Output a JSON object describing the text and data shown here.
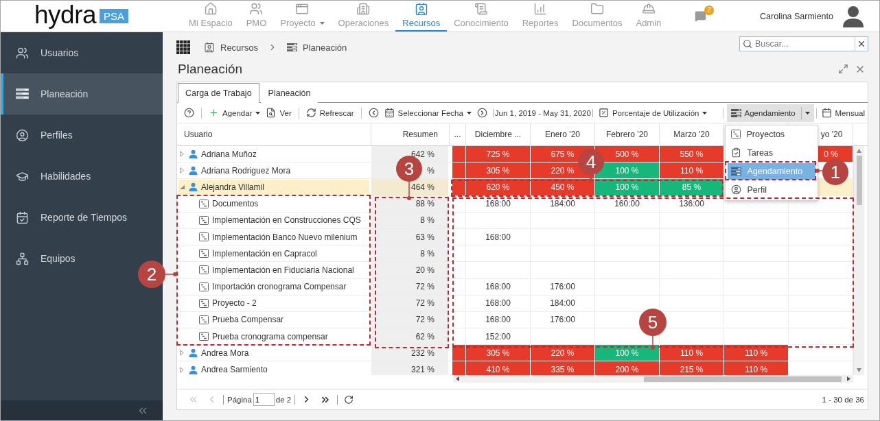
{
  "top_bar": {
    "logo": {
      "name": "hydra",
      "badge": "PSA"
    },
    "nav": [
      {
        "kind": "home",
        "label": "Mi Espacio",
        "selected": false
      },
      {
        "kind": "team",
        "label": "PMO",
        "selected": false
      },
      {
        "kind": "project",
        "label": "Proyecto",
        "selected": false,
        "caret": true
      },
      {
        "kind": "operations",
        "label": "Operaciones",
        "selected": false
      },
      {
        "kind": "resources",
        "label": "Recursos",
        "selected": true
      },
      {
        "kind": "knowledge",
        "label": "Conocimiento",
        "selected": false
      },
      {
        "kind": "reports",
        "label": "Reportes",
        "selected": false
      },
      {
        "kind": "documents",
        "label": "Documentos",
        "selected": false
      },
      {
        "kind": "admin",
        "label": "Admin",
        "selected": false
      }
    ],
    "notifications": {
      "count": "2"
    },
    "user": {
      "name": "Carolina Sarmiento"
    }
  },
  "sidebar": {
    "items": [
      {
        "kind": "users",
        "label": "Usuarios",
        "selected": false
      },
      {
        "kind": "planning",
        "label": "Planeación",
        "selected": true
      },
      {
        "kind": "profiles",
        "label": "Perfiles",
        "selected": false
      },
      {
        "kind": "skills",
        "label": "Habilidades",
        "selected": false
      },
      {
        "kind": "timesheet",
        "label": "Reporte de Tiempos",
        "selected": false
      },
      {
        "kind": "teams",
        "label": "Equipos",
        "selected": false
      }
    ]
  },
  "breadcrumb": [
    {
      "kind": "resources",
      "label": "Recursos"
    },
    {
      "kind": "planning",
      "label": "Planeación"
    }
  ],
  "search": {
    "placeholder": "Buscar..."
  },
  "page_title": "Planeación",
  "tabs": [
    {
      "label": "Carga de Trabajo",
      "selected": true
    },
    {
      "label": "Planeación",
      "selected": false
    }
  ],
  "toolbar": [
    {
      "kind": "help"
    },
    {
      "kind": "divider"
    },
    {
      "kind": "add",
      "label": "Agendar",
      "caret": true
    },
    {
      "kind": "view",
      "label": "Ver"
    },
    {
      "kind": "divider"
    },
    {
      "kind": "refresh",
      "label": "Refrescar"
    },
    {
      "kind": "divider"
    },
    {
      "kind": "previous"
    },
    {
      "kind": "date",
      "label": "Seleccionar Fecha",
      "caret": true
    },
    {
      "kind": "next"
    },
    {
      "kind": "range",
      "label": "Jun 1, 2019 - May 31, 2020"
    },
    {
      "kind": "metric",
      "label": "Porcentaje de Utilización",
      "caret": true
    },
    {
      "kind": "divider"
    },
    {
      "kind": "mode",
      "label": "Agendamiento",
      "caret": true,
      "pressed": true,
      "menu": [
        {
          "kind": "projects",
          "label": "Proyectos",
          "selected": false
        },
        {
          "kind": "tasks",
          "label": "Tareas",
          "selected": false
        },
        {
          "kind": "scheduling",
          "label": "Agendamiento",
          "selected": true
        },
        {
          "kind": "profile",
          "label": "Perfil",
          "selected": false
        }
      ]
    },
    {
      "kind": "divider"
    },
    {
      "kind": "period",
      "label": "Mensual"
    }
  ],
  "grid": {
    "user_column": "Usuario",
    "summary_column": "Resumen",
    "columns": [
      {
        "label": "..."
      },
      {
        "label": "Diciembre ..."
      },
      {
        "label": "Enero '20"
      },
      {
        "label": "Febrero '20"
      },
      {
        "label": "Marzo '20"
      },
      {},
      {
        "label": "yo '20"
      }
    ],
    "rows": [
      {
        "name": "Adriana Muñoz",
        "expanded": false,
        "selected": false,
        "summary": "642 %",
        "cells": [
          {
            "color": "#e63a2a"
          },
          {
            "value": "725 %",
            "color": "#e63a2a"
          },
          {
            "value": "675 %",
            "color": "#e63a2a"
          },
          {
            "value": "500 %",
            "color": "#e63a2a"
          },
          {
            "value": "550 %",
            "color": "#e63a2a"
          },
          {},
          {
            "value": "0 %",
            "color": "#e63a2a"
          }
        ]
      },
      {
        "name": "Adriana Rodriguez Mora",
        "expanded": false,
        "selected": false,
        "summary": "%",
        "cells": [
          {
            "color": "#e63a2a"
          },
          {
            "value": "305 %",
            "color": "#e63a2a"
          },
          {
            "value": "220 %",
            "color": "#e63a2a"
          },
          {
            "value": "100 %",
            "color": "#17b67b"
          },
          {
            "value": "110 %",
            "color": "#e63a2a"
          },
          {},
          {}
        ]
      },
      {
        "name": "Alejandra Villamil",
        "expanded": true,
        "selected": true,
        "summary": "464 %",
        "cells": [
          {
            "color": "#e63a2a"
          },
          {
            "value": "620 %",
            "color": "#e63a2a"
          },
          {
            "value": "450 %",
            "color": "#e63a2a"
          },
          {
            "value": "100 %",
            "color": "#17b67b"
          },
          {
            "value": "85 %",
            "color": "#17b67b"
          },
          {},
          {}
        ],
        "children": [
          {
            "name": "Documentos",
            "selected": false,
            "summary": "88 %",
            "cells": [
              {},
              {
                "value": "168:00"
              },
              {
                "value": "184:00"
              },
              {
                "value": "160:00"
              },
              {
                "value": "136:00"
              },
              {},
              {}
            ]
          },
          {
            "name": "Implementación en Construcciones CQS",
            "selected": false,
            "summary": "8 %",
            "cells": [
              {},
              {},
              {},
              {},
              {},
              {},
              {}
            ]
          },
          {
            "name": "Implementación Banco Nuevo milenium",
            "selected": false,
            "summary": "63 %",
            "cells": [
              {},
              {
                "value": "168:00"
              },
              {},
              {},
              {},
              {},
              {}
            ]
          },
          {
            "name": "Implementación en Capracol",
            "selected": false,
            "summary": "8 %",
            "cells": [
              {},
              {},
              {},
              {},
              {},
              {},
              {}
            ]
          },
          {
            "name": "Implementación en Fiduciaria Nacional",
            "selected": false,
            "summary": "20 %",
            "cells": [
              {},
              {},
              {},
              {},
              {},
              {},
              {}
            ]
          },
          {
            "name": "Importación cronograma Compensar",
            "selected": false,
            "summary": "72 %",
            "cells": [
              {},
              {
                "value": "168:00"
              },
              {
                "value": "176:00"
              },
              {},
              {},
              {},
              {}
            ]
          },
          {
            "name": "Proyecto - 2",
            "selected": false,
            "summary": "72 %",
            "cells": [
              {},
              {
                "value": "168:00"
              },
              {
                "value": "184:00"
              },
              {},
              {},
              {},
              {}
            ]
          },
          {
            "name": "Prueba Compensar",
            "selected": false,
            "summary": "72 %",
            "cells": [
              {},
              {
                "value": "168:00"
              },
              {
                "value": "176:00"
              },
              {},
              {},
              {},
              {}
            ]
          },
          {
            "name": "Prueba cronograma compensar",
            "selected": false,
            "summary": "62 %",
            "cells": [
              {},
              {
                "value": "152:00"
              },
              {},
              {},
              {},
              {},
              {}
            ]
          }
        ]
      },
      {
        "name": "Andrea Mora",
        "expanded": false,
        "selected": false,
        "summary": "232 %",
        "cells": [
          {
            "color": "#e63a2a"
          },
          {
            "value": "305 %",
            "color": "#e63a2a"
          },
          {
            "value": "220 %",
            "color": "#e63a2a"
          },
          {
            "value": "100 %",
            "color": "#17b67b"
          },
          {
            "value": "110 %",
            "color": "#e63a2a"
          },
          {
            "value": "110 %",
            "color": "#e63a2a"
          },
          {}
        ]
      },
      {
        "name": "Andrea Sarmiento",
        "expanded": false,
        "selected": false,
        "summary": "321 %",
        "cells": [
          {
            "color": "#e63a2a"
          },
          {
            "value": "410 %",
            "color": "#e63a2a"
          },
          {
            "value": "335 %",
            "color": "#e63a2a"
          },
          {
            "value": "200 %",
            "color": "#e63a2a"
          },
          {
            "value": "215 %",
            "color": "#e63a2a"
          },
          {
            "value": "110 %",
            "color": "#e63a2a"
          },
          {}
        ]
      }
    ]
  },
  "pager": {
    "first": {
      "disabled": true
    },
    "previous": {
      "disabled": true
    },
    "page_label": "Página",
    "page": "1",
    "total_label": "de 2",
    "next": {
      "disabled": false
    },
    "last": {
      "disabled": false
    },
    "range": "1 - 30 de 36"
  },
  "callouts": [
    {
      "number": "1"
    },
    {
      "number": "2"
    },
    {
      "number": "3"
    },
    {
      "number": "4"
    },
    {
      "number": "5"
    }
  ]
}
